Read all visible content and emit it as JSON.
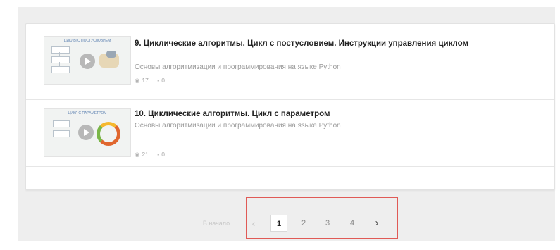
{
  "items": [
    {
      "title": "9. Циклические алгоритмы. Цикл с постусловием. Инструкции управления циклом",
      "subtitle": "Основы алгоритмизации и программирования на языке Python",
      "views": "17",
      "comments": "0",
      "thumb_caption": "ЦИКЛЫ С ПОСТУСЛОВИЕМ"
    },
    {
      "title": "10. Циклические алгоритмы. Цикл с параметром",
      "subtitle": "Основы алгоритмизации и программирования на языке Python",
      "views": "21",
      "comments": "0",
      "thumb_caption": "ЦИКЛ С ПАРАМЕТРОМ"
    }
  ],
  "pagination": {
    "start_label": "В начало",
    "prev": "‹",
    "pages": [
      "1",
      "2",
      "3",
      "4"
    ],
    "next": "›",
    "current": "1"
  },
  "icons": {
    "views": "eye-icon",
    "comments": "comment-icon"
  },
  "colors": {
    "highlight": "#e05a56",
    "title": "#222222",
    "subtitle": "#9a9a9a"
  }
}
